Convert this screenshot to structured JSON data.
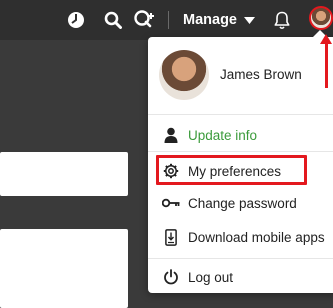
{
  "topbar": {
    "manage_label": "Manage"
  },
  "dropdown": {
    "user_name": "James Brown",
    "items": [
      {
        "label": "Update info"
      },
      {
        "label": "My preferences"
      },
      {
        "label": "Change password"
      },
      {
        "label": "Download mobile apps"
      },
      {
        "label": "Log out"
      }
    ]
  },
  "colors": {
    "topbar_bg": "#2f2f2f",
    "update_info": "#3b9b3b",
    "highlight": "#e3181e"
  }
}
